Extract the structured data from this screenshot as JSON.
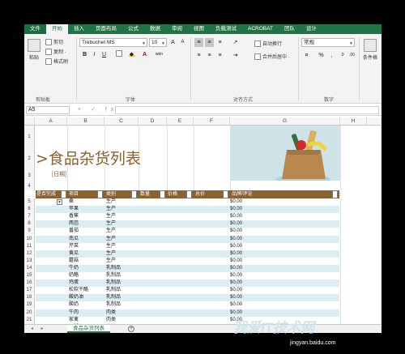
{
  "ribbon_tabs": [
    "文件",
    "开始",
    "插入",
    "页面布局",
    "公式",
    "数据",
    "审阅",
    "视图",
    "负载测试",
    "ACROBAT",
    "团队",
    "设计"
  ],
  "clipboard": {
    "paste": "粘贴",
    "cut": "剪切",
    "copy": "复制 ·",
    "format_painter": "格式刷",
    "label": "剪贴板"
  },
  "font": {
    "name": "Trebuchet MS",
    "size": "10",
    "label": "字体",
    "bold": "B",
    "italic": "I",
    "underline": "U",
    "grow": "A",
    "shrink": "A",
    "wen": "wén"
  },
  "alignment": {
    "wrap": "自动换行",
    "merge": "合并后居中 ·",
    "label": "对齐方式"
  },
  "number": {
    "format": "常规",
    "currency": "·",
    "percent": "%",
    "comma": ",",
    "label": "数字",
    "inc_decimal": ".0",
    "dec_decimal": ".00"
  },
  "styles": {
    "conditional": "条件格"
  },
  "formula_bar": {
    "name_box": "A5",
    "icons": "× ✓ fx"
  },
  "columns": [
    "A",
    "B",
    "C",
    "D",
    "E",
    "F",
    "G",
    "H"
  ],
  "rows": [
    "1",
    "2",
    "3",
    "4",
    "5",
    "6",
    "7",
    "8",
    "9",
    "10",
    "11",
    "12",
    "13",
    "14",
    "15",
    "16",
    "17",
    "18",
    "19",
    "20",
    "21",
    "22"
  ],
  "title": ">食品杂货列表",
  "date_label": "[日期]",
  "table": {
    "headers": [
      "是否完成",
      "项目",
      "类别",
      "数量",
      "价格",
      "总价",
      "品牌/评论"
    ],
    "rows": [
      {
        "item": "桑",
        "category": "生产",
        "total": "$0.00"
      },
      {
        "item": "苹果",
        "category": "生产",
        "total": "$0.00"
      },
      {
        "item": "香蕉",
        "category": "生产",
        "total": "$0.00"
      },
      {
        "item": "两芭",
        "category": "生产",
        "total": "$0.00"
      },
      {
        "item": "番茄",
        "category": "生产",
        "total": "$0.00"
      },
      {
        "item": "南瓜",
        "category": "生产",
        "total": "$0.00"
      },
      {
        "item": "芹菜",
        "category": "生产",
        "total": "$0.00"
      },
      {
        "item": "黄瓜",
        "category": "生产",
        "total": "$0.00"
      },
      {
        "item": "蘑菇",
        "category": "生产",
        "total": "$0.00"
      },
      {
        "item": "牛奶",
        "category": "乳制品",
        "total": "$0.00"
      },
      {
        "item": "奶酪",
        "category": "乳制品",
        "total": "$0.00"
      },
      {
        "item": "鸡蛋",
        "category": "乳制品",
        "total": "$0.00"
      },
      {
        "item": "松软干酪",
        "category": "乳制品",
        "total": "$0.00"
      },
      {
        "item": "酸奶油",
        "category": "乳制品",
        "total": "$0.00"
      },
      {
        "item": "酸奶",
        "category": "乳制品",
        "total": "$0.00"
      },
      {
        "item": "牛肉",
        "category": "肉类",
        "total": "$0.00"
      },
      {
        "item": "家禽",
        "category": "肉类",
        "total": "$0.00"
      },
      {
        "item": "火腿",
        "category": "肉类",
        "total": "$0.00"
      }
    ]
  },
  "sheet_tab": "食品杂货列表",
  "add_sheet": "+",
  "watermark": "我爱IT技术网",
  "watermark_url": "jingyan.baidu.com",
  "colors": {
    "excel_green": "#217346",
    "brown": "#8a6130",
    "band": "#ddeef2"
  }
}
